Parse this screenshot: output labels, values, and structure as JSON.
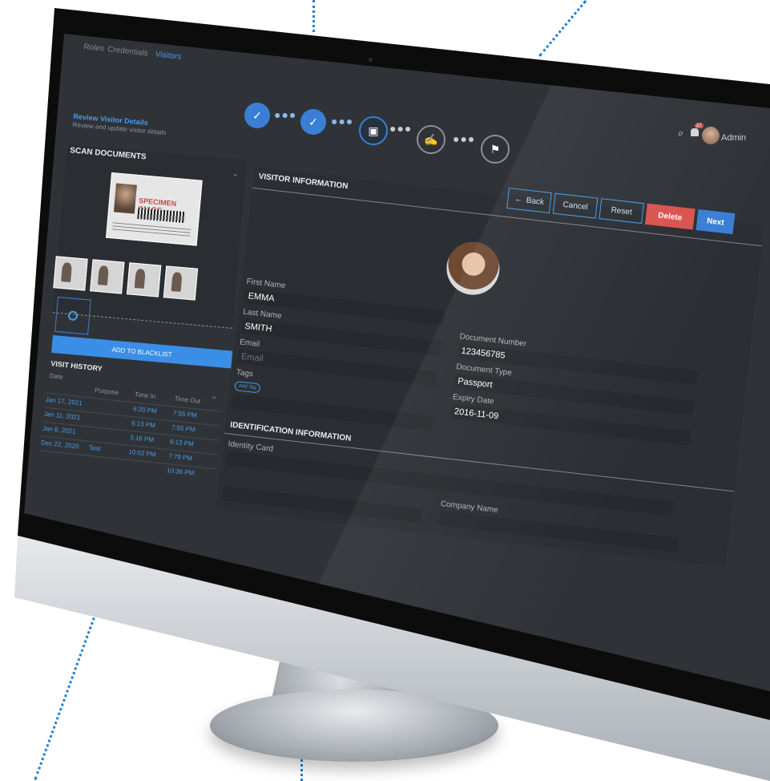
{
  "app": {
    "tabs": [
      "Roles",
      "Credentials",
      "Visitors"
    ],
    "active_tab": "Visitors",
    "notification_count": "27",
    "user_name": "Admin"
  },
  "page": {
    "title": "Review Visitor Details",
    "subtitle": "Review and update visitor details"
  },
  "steps": [
    {
      "state": "done",
      "icon": "check-icon"
    },
    {
      "state": "done",
      "icon": "check-icon"
    },
    {
      "state": "active",
      "icon": "document-icon"
    },
    {
      "state": "pending",
      "icon": "sign-icon"
    },
    {
      "state": "pending",
      "icon": "badge-icon"
    }
  ],
  "scan": {
    "header": "SCAN DOCUMENTS",
    "stamp": "SPECIMEN IMAGE",
    "thumb_count": 4,
    "add_to_blacklist": "ADD TO BLACKLIST"
  },
  "history": {
    "header": "VISIT HISTORY",
    "columns": [
      "Date",
      "Purpose",
      "Time In",
      "Time Out"
    ],
    "rows": [
      {
        "date": "Jan 17, 2021",
        "purpose": "",
        "time_in": "6:20 PM",
        "time_out": "7:55 PM"
      },
      {
        "date": "Jan 11, 2021",
        "purpose": "",
        "time_in": "6:13 PM",
        "time_out": "7:55 PM"
      },
      {
        "date": "Jan 8, 2021",
        "purpose": "",
        "time_in": "5:16 PM",
        "time_out": "6:13 PM"
      },
      {
        "date": "Dec 22, 2020",
        "purpose": "Test",
        "time_in": "10:02 PM",
        "time_out": "7:79 PM"
      },
      {
        "date": "",
        "purpose": "",
        "time_in": "",
        "time_out": "10:36 PM"
      }
    ]
  },
  "visitor": {
    "header": "VISITOR INFORMATION",
    "buttons": {
      "back": "Back",
      "cancel": "Cancel",
      "reset": "Reset",
      "delete": "Delete",
      "next": "Next"
    },
    "first_name_label": "First Name",
    "first_name": "EMMA",
    "last_name_label": "Last Name",
    "last_name": "SMITH",
    "email_label": "Email",
    "email_placeholder": "Email",
    "tags_label": "Tags",
    "tag_button": "Add Tag",
    "doc_number_label": "Document Number",
    "doc_number": "123456785",
    "doc_type_label": "Document Type",
    "doc_type": "Passport",
    "expiry_label": "Expiry Date",
    "expiry": "2016-11-09"
  },
  "identification": {
    "header": "IDENTIFICATION INFORMATION",
    "identity_card_label": "Identity Card",
    "company_name_label": "Company Name"
  },
  "colors": {
    "accent": "#4a9be8",
    "delete": "#d9534f",
    "next": "#3a7fd5",
    "screen_bg": "#2f3338"
  }
}
